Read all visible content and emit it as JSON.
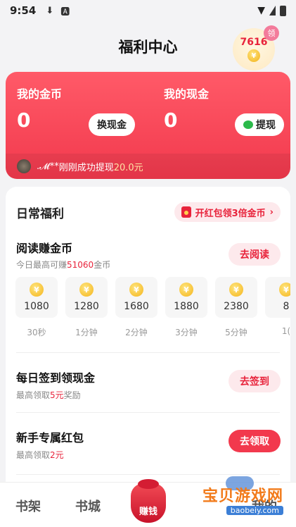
{
  "status_bar": {
    "time": "9:54",
    "icons": [
      "download-icon",
      "a-badge-icon",
      "wifi-icon",
      "signal-icon",
      "battery-icon"
    ]
  },
  "header": {
    "title": "福利中心",
    "coin_count": "7616",
    "claim_label": "领"
  },
  "wallet": {
    "coins_label": "我的金币",
    "coins_value": "0",
    "exchange_button": "换现金",
    "cash_label": "我的现金",
    "cash_value": "0",
    "withdraw_button": "提现",
    "ticker_user": ".𝓜**",
    "ticker_text": "刚刚成功提现",
    "ticker_amount": "20.0元"
  },
  "daily": {
    "title": "日常福利",
    "redpack_button": "开红包领3倍金币",
    "read_task": {
      "title": "阅读赚金币",
      "sub_prefix": "今日最高可赚",
      "sub_value": "51060",
      "sub_suffix": "金币",
      "button": "去阅读"
    },
    "rewards": [
      {
        "amount": "1080",
        "duration": "30秒"
      },
      {
        "amount": "1280",
        "duration": "1分钟"
      },
      {
        "amount": "1680",
        "duration": "2分钟"
      },
      {
        "amount": "1880",
        "duration": "3分钟"
      },
      {
        "amount": "2380",
        "duration": "5分钟"
      },
      {
        "amount": "8",
        "duration": "1("
      }
    ],
    "checkin_task": {
      "title": "每日签到领现金",
      "sub_prefix": "最高领取",
      "sub_value": "5元",
      "sub_suffix": "奖励",
      "button": "去签到"
    },
    "newbie_task": {
      "title": "新手专属红包",
      "sub_prefix": "最高领取",
      "sub_value": "2元",
      "button": "去领取"
    }
  },
  "tabs": {
    "bookshelf": "书架",
    "bookstore": "书城",
    "earn": "赚钱",
    "mine": "我的"
  },
  "watermark": {
    "text": "宝贝游戏网",
    "url": "baobeiy.com"
  },
  "colors": {
    "accent": "#f2394d",
    "soft_accent": "#fde9ec",
    "coin": "#f4b51d"
  }
}
